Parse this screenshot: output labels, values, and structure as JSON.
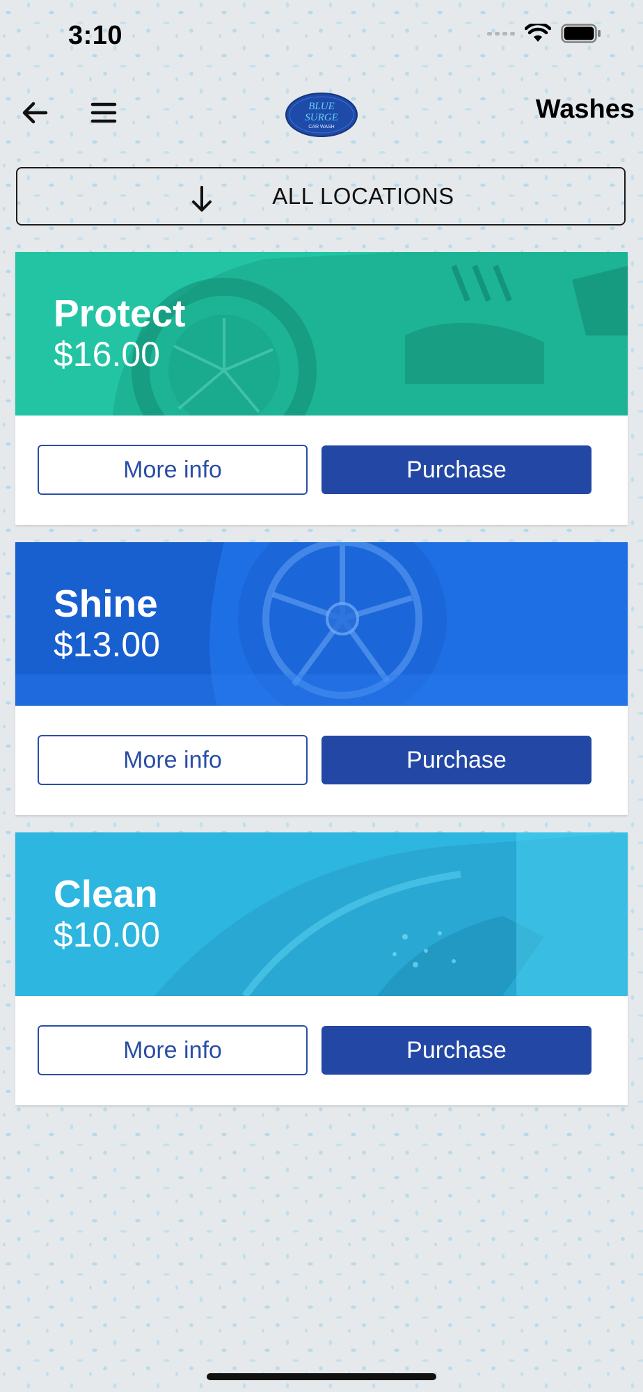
{
  "status_bar": {
    "time": "3:10"
  },
  "nav": {
    "title": "Washes",
    "logo_text": "BLUE SURGE CAR WASH",
    "back_icon": "arrow-left-icon",
    "menu_icon": "hamburger-menu-icon"
  },
  "location_selector": {
    "label": "ALL LOCATIONS",
    "icon": "arrow-down-icon"
  },
  "washes": [
    {
      "name": "Protect",
      "price": "$16.00",
      "color": "#22c4a4",
      "more_label": "More info",
      "purchase_label": "Purchase"
    },
    {
      "name": "Shine",
      "price": "$13.00",
      "color": "#1f6fe4",
      "more_label": "More info",
      "purchase_label": "Purchase"
    },
    {
      "name": "Clean",
      "price": "$10.00",
      "color": "#2db6e0",
      "more_label": "More info",
      "purchase_label": "Purchase"
    }
  ],
  "colors": {
    "primary_button": "#2347a4",
    "outline_button": "#2a4ea6",
    "background": "#e6e9ec"
  }
}
